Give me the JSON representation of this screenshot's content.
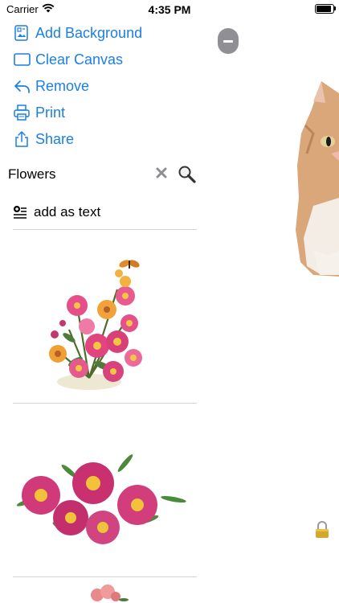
{
  "status_bar": {
    "carrier": "Carrier",
    "time": "4:35 PM"
  },
  "menu": [
    {
      "label": "Add Background",
      "icon": "add-background-icon"
    },
    {
      "label": "Clear Canvas",
      "icon": "clear-canvas-icon"
    },
    {
      "label": "Remove",
      "icon": "remove-icon"
    },
    {
      "label": "Print",
      "icon": "print-icon"
    },
    {
      "label": "Share",
      "icon": "share-icon"
    }
  ],
  "search": {
    "query": "Flowers",
    "clear_icon": "close-icon",
    "search_icon": "magnifier-icon"
  },
  "add_as_text": {
    "label": "add as text",
    "icon": "add-text-icon"
  },
  "results": [
    "flower-bouquet-image",
    "flower-garland-image",
    "flower-image"
  ],
  "canvas": {
    "collapse_icon": "minus-icon",
    "lock_icon": "lock-icon",
    "sticker": "kitten-image"
  },
  "colors": {
    "accent": "#1a7fe6",
    "button_gray": "#8f8f94"
  }
}
